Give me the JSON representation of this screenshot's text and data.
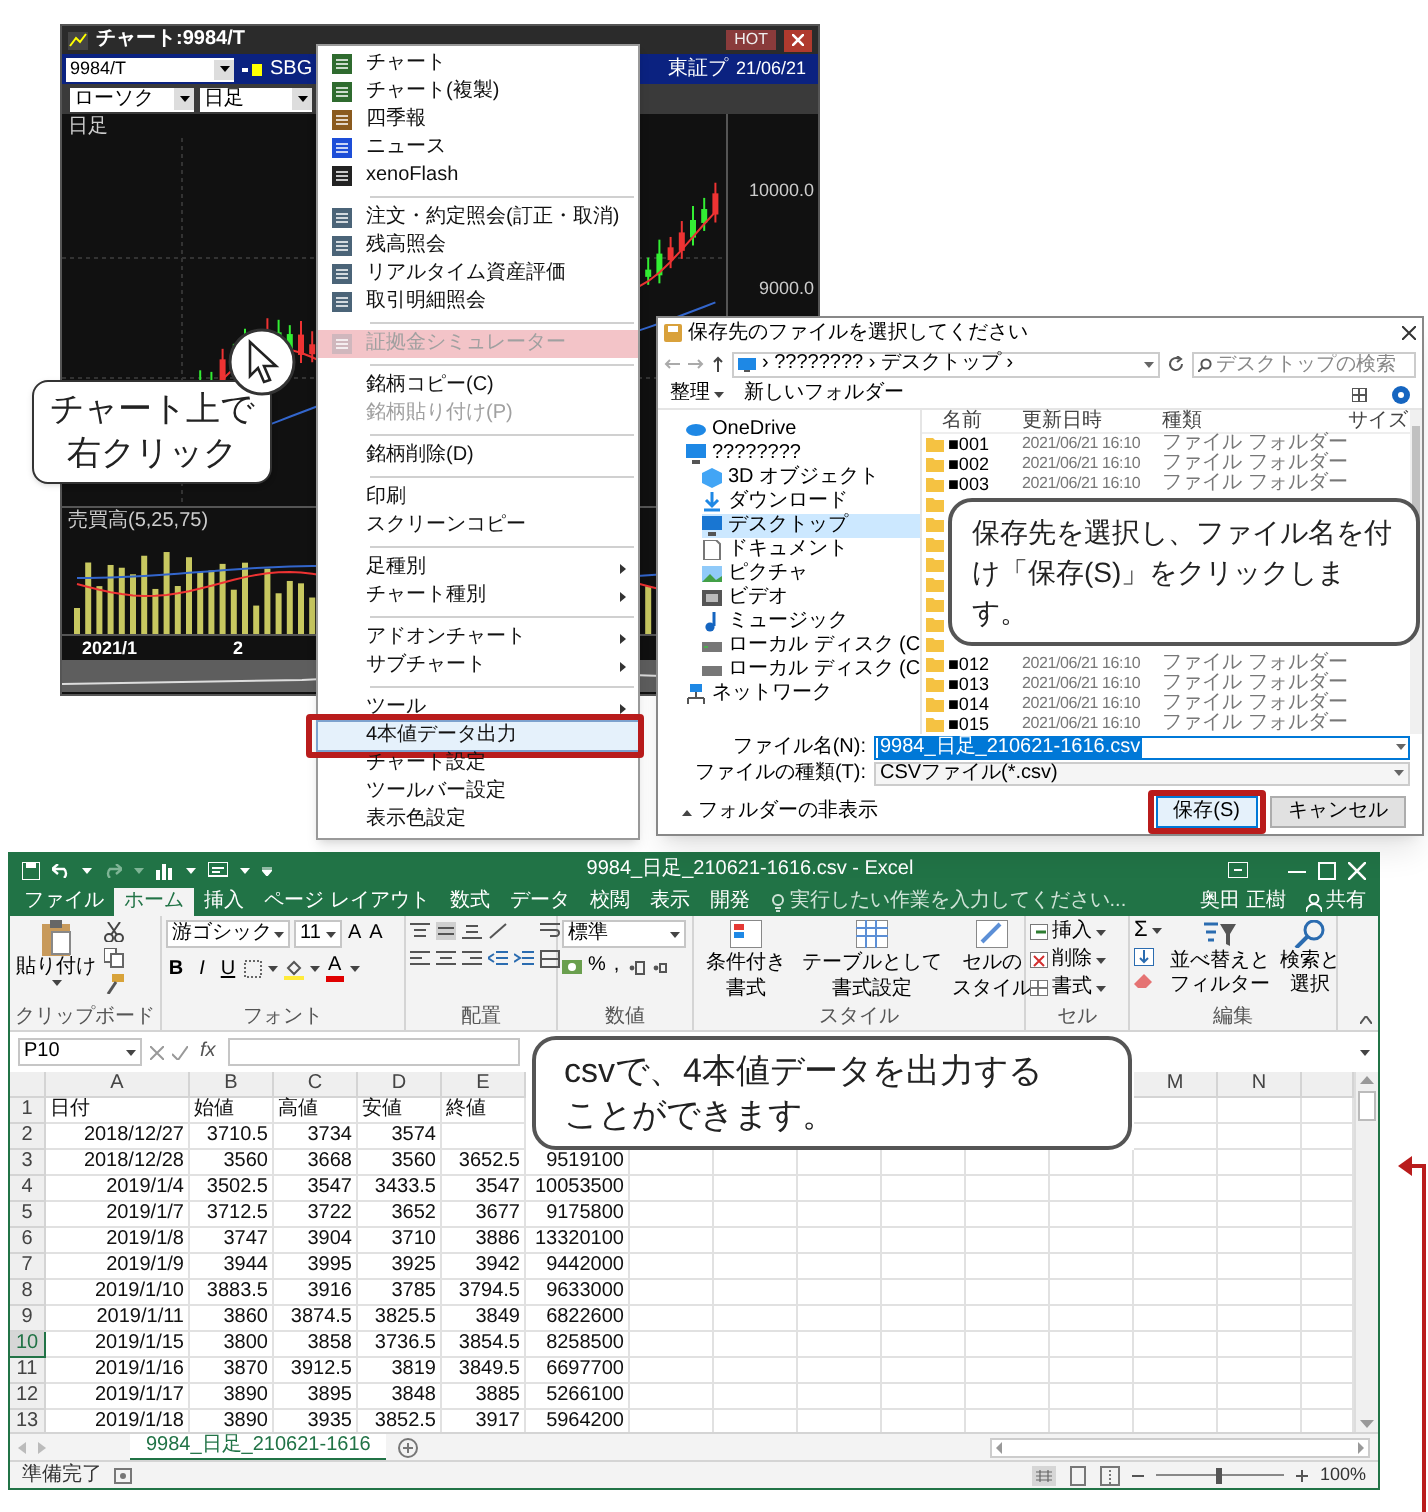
{
  "chart_window": {
    "title": "チャート:9984/T",
    "badge": "HOT",
    "symbol": "9984/T",
    "symbol_name": "SBG",
    "market": "東証プ",
    "date": "21/06/21",
    "chart_type": "ローソク",
    "period": "日足",
    "price_pane_label": "日足",
    "price_axis": [
      "10000.0",
      "9000.0"
    ],
    "volume_pane_label": "売買高(5,25,75)",
    "x_axis": [
      "2021/1",
      "2"
    ]
  },
  "context_menu": {
    "items": [
      {
        "kind": "icon_item",
        "label": "チャート",
        "disabled": false,
        "submenu": false,
        "selected": false,
        "highlighted": false
      },
      {
        "kind": "icon_item",
        "label": "チャート(複製)",
        "disabled": false,
        "submenu": false,
        "selected": false,
        "highlighted": false
      },
      {
        "kind": "icon_item",
        "label": "四季報",
        "disabled": false,
        "submenu": false,
        "selected": false,
        "highlighted": false
      },
      {
        "kind": "icon_item",
        "label": "ニュース",
        "disabled": false,
        "submenu": false,
        "selected": false,
        "highlighted": false
      },
      {
        "kind": "icon_item",
        "label": "xenoFlash",
        "disabled": false,
        "submenu": false,
        "selected": false,
        "highlighted": false
      },
      {
        "kind": "separator"
      },
      {
        "kind": "icon_item",
        "label": "注文・約定照会(訂正・取消)",
        "disabled": false,
        "submenu": false,
        "selected": false,
        "highlighted": false
      },
      {
        "kind": "icon_item",
        "label": "残高照会",
        "disabled": false,
        "submenu": false,
        "selected": false,
        "highlighted": false
      },
      {
        "kind": "icon_item",
        "label": "リアルタイム資産評価",
        "disabled": false,
        "submenu": false,
        "selected": false,
        "highlighted": false
      },
      {
        "kind": "icon_item",
        "label": "取引明細照会",
        "disabled": false,
        "submenu": false,
        "selected": false,
        "highlighted": false
      },
      {
        "kind": "separator"
      },
      {
        "kind": "icon_item",
        "label": "証拠金シミュレーター",
        "disabled": true,
        "submenu": false,
        "selected": false,
        "highlighted": true
      },
      {
        "kind": "separator"
      },
      {
        "kind": "item",
        "label": "銘柄コピー(C)",
        "disabled": false,
        "submenu": false,
        "selected": false,
        "highlighted": false
      },
      {
        "kind": "item",
        "label": "銘柄貼り付け(P)",
        "disabled": true,
        "submenu": false,
        "selected": false,
        "highlighted": false
      },
      {
        "kind": "separator"
      },
      {
        "kind": "item",
        "label": "銘柄削除(D)",
        "disabled": false,
        "submenu": false,
        "selected": false,
        "highlighted": false
      },
      {
        "kind": "separator"
      },
      {
        "kind": "item",
        "label": "印刷",
        "disabled": false,
        "submenu": false,
        "selected": false,
        "highlighted": false
      },
      {
        "kind": "item",
        "label": "スクリーンコピー",
        "disabled": false,
        "submenu": false,
        "selected": false,
        "highlighted": false
      },
      {
        "kind": "separator"
      },
      {
        "kind": "item",
        "label": "足種別",
        "disabled": false,
        "submenu": true,
        "selected": false,
        "highlighted": false
      },
      {
        "kind": "item",
        "label": "チャート種別",
        "disabled": false,
        "submenu": true,
        "selected": false,
        "highlighted": false
      },
      {
        "kind": "separator"
      },
      {
        "kind": "item",
        "label": "アドオンチャート",
        "disabled": false,
        "submenu": true,
        "selected": false,
        "highlighted": false
      },
      {
        "kind": "item",
        "label": "サブチャート",
        "disabled": false,
        "submenu": true,
        "selected": false,
        "highlighted": false
      },
      {
        "kind": "separator"
      },
      {
        "kind": "item",
        "label": "ツール",
        "disabled": false,
        "submenu": true,
        "selected": false,
        "highlighted": false
      },
      {
        "kind": "item",
        "label": "4本値データ出力",
        "disabled": false,
        "submenu": false,
        "selected": true,
        "highlighted": false
      },
      {
        "kind": "item",
        "label": "チャート設定",
        "disabled": false,
        "submenu": false,
        "selected": false,
        "highlighted": false
      },
      {
        "kind": "item",
        "label": "ツールバー設定",
        "disabled": false,
        "submenu": false,
        "selected": false,
        "highlighted": false
      },
      {
        "kind": "item",
        "label": "表示色設定",
        "disabled": false,
        "submenu": false,
        "selected": false,
        "highlighted": false
      }
    ]
  },
  "save_dialog": {
    "title": "保存先のファイルを選択してください",
    "path": "› ???????? › デスクトップ ›",
    "search_placeholder": "デスクトップの検索",
    "toolbar": [
      "整理",
      "新しいフォルダー"
    ],
    "nav": [
      {
        "label": "OneDrive",
        "selected": false
      },
      {
        "label": "????????",
        "selected": false,
        "children": [
          {
            "label": "3D オブジェクト",
            "selected": false
          },
          {
            "label": "ダウンロード",
            "selected": false
          },
          {
            "label": "デスクトップ",
            "selected": true
          },
          {
            "label": "ドキュメント",
            "selected": false
          },
          {
            "label": "ピクチャ",
            "selected": false
          },
          {
            "label": "ビデオ",
            "selected": false
          },
          {
            "label": "ミュージック",
            "selected": false
          },
          {
            "label": "ローカル ディスク (C",
            "selected": false
          },
          {
            "label": "ローカル ディスク (C",
            "selected": false
          }
        ]
      },
      {
        "label": "ネットワーク",
        "selected": false
      }
    ],
    "columns": [
      "名前",
      "更新日時",
      "種類",
      "サイズ"
    ],
    "files": [
      {
        "kind": "folder",
        "name": "■001",
        "modified": "2021/06/21 16:10",
        "type": "ファイル フォルダー"
      },
      {
        "kind": "folder",
        "name": "■002",
        "modified": "2021/06/21 16:10",
        "type": "ファイル フォルダー"
      },
      {
        "kind": "folder",
        "name": "■003",
        "modified": "2021/06/21 16:10",
        "type": "ファイル フォルダー"
      },
      {
        "kind": "covered"
      },
      {
        "kind": "covered"
      },
      {
        "kind": "covered"
      },
      {
        "kind": "covered"
      },
      {
        "kind": "covered"
      },
      {
        "kind": "covered"
      },
      {
        "kind": "covered"
      },
      {
        "kind": "covered"
      },
      {
        "kind": "folder",
        "name": "■012",
        "modified": "2021/06/21 16:10",
        "type": "ファイル フォルダー"
      },
      {
        "kind": "folder",
        "name": "■013",
        "modified": "2021/06/21 16:10",
        "type": "ファイル フォルダー"
      },
      {
        "kind": "folder",
        "name": "■014",
        "modified": "2021/06/21 16:10",
        "type": "ファイル フォルダー"
      },
      {
        "kind": "folder",
        "name": "■015",
        "modified": "2021/06/21 16:10",
        "type": "ファイル フォルダー"
      }
    ],
    "file_name_label": "ファイル名(N):",
    "file_name": {
      "value": "9984_日足_210621-1616.csv",
      "highlighted": true
    },
    "file_type_label": "ファイルの種類(T):",
    "file_type": "CSVファイル(*.csv)",
    "hide_folders": "フォルダーの非表示",
    "buttons": [
      {
        "label": "保存(S)",
        "highlighted": true
      },
      {
        "label": "キャンセル",
        "highlighted": false
      }
    ]
  },
  "excel": {
    "title": "9984_日足_210621-1616.csv - Excel",
    "tabs": [
      {
        "label": "ファイル",
        "selected": false
      },
      {
        "label": "ホーム",
        "selected": true
      },
      {
        "label": "挿入",
        "selected": false
      },
      {
        "label": "ページ レイアウト",
        "selected": false
      },
      {
        "label": "数式",
        "selected": false
      },
      {
        "label": "データ",
        "selected": false
      },
      {
        "label": "校閲",
        "selected": false
      },
      {
        "label": "表示",
        "selected": false
      },
      {
        "label": "開発",
        "selected": false
      }
    ],
    "tell_me": "実行したい作業を入力してください...",
    "user": "奥田 正樹",
    "share": "共有",
    "ribbon": {
      "clipboard": {
        "paste": "貼り付け",
        "label": "クリップボード"
      },
      "font": {
        "name": "游ゴシック",
        "size": "11",
        "grow": "A",
        "shrink": "A",
        "format": [
          "B",
          "I",
          "U"
        ],
        "color_button": "A",
        "label": "フォント"
      },
      "alignment": {
        "label": "配置"
      },
      "number": {
        "format": "標準",
        "percent": "%",
        "comma": ",",
        "label": "数値"
      },
      "styles": {
        "buttons": [
          {
            "lines": [
              "条件付き",
              "書式"
            ]
          },
          {
            "lines": [
              "テーブルとして",
              "書式設定"
            ]
          },
          {
            "lines": [
              "セルの",
              "スタイル"
            ]
          }
        ],
        "label": "スタイル"
      },
      "cells": {
        "buttons": [
          "挿入",
          "削除",
          "書式"
        ],
        "label": "セル"
      },
      "editing": {
        "sum": "Σ",
        "buttons": [
          {
            "lines": [
              "並べ替えと",
              "フィルター"
            ]
          },
          {
            "lines": [
              "検索と",
              "選択"
            ]
          }
        ],
        "label": "編集"
      }
    },
    "name_box": "P10",
    "formula_button": "fx",
    "column_headers": [
      "A",
      "B",
      "C",
      "D",
      "E",
      "M",
      "N"
    ],
    "rows": [
      {
        "header": "1",
        "kind": "header",
        "selected": false,
        "cells": [
          "日付",
          "始値",
          "高値",
          "安値",
          "終値"
        ]
      },
      {
        "header": "2",
        "kind": "data",
        "selected": false,
        "cells": [
          "2018/12/27",
          "3710.5",
          "3734",
          "3574"
        ]
      },
      {
        "header": "3",
        "kind": "data",
        "selected": false,
        "cells": [
          "2018/12/28",
          "3560",
          "3668",
          "3560",
          "3652.5",
          "9519100"
        ]
      },
      {
        "header": "4",
        "kind": "data",
        "selected": false,
        "cells": [
          "2019/1/4",
          "3502.5",
          "3547",
          "3433.5",
          "3547",
          "10053500"
        ]
      },
      {
        "header": "5",
        "kind": "data",
        "selected": false,
        "cells": [
          "2019/1/7",
          "3712.5",
          "3722",
          "3652",
          "3677",
          "9175800"
        ]
      },
      {
        "header": "6",
        "kind": "data",
        "selected": false,
        "cells": [
          "2019/1/8",
          "3747",
          "3904",
          "3710",
          "3886",
          "13320100"
        ]
      },
      {
        "header": "7",
        "kind": "data",
        "selected": false,
        "cells": [
          "2019/1/9",
          "3944",
          "3995",
          "3925",
          "3942",
          "9442000"
        ]
      },
      {
        "header": "8",
        "kind": "data",
        "selected": false,
        "cells": [
          "2019/1/10",
          "3883.5",
          "3916",
          "3785",
          "3794.5",
          "9633000"
        ]
      },
      {
        "header": "9",
        "kind": "data",
        "selected": false,
        "cells": [
          "2019/1/11",
          "3860",
          "3874.5",
          "3825.5",
          "3849",
          "6822600"
        ]
      },
      {
        "header": "10",
        "kind": "data",
        "selected": true,
        "cells": [
          "2019/1/15",
          "3800",
          "3858",
          "3736.5",
          "3854.5",
          "8258500"
        ]
      },
      {
        "header": "11",
        "kind": "data",
        "selected": false,
        "cells": [
          "2019/1/16",
          "3870",
          "3912.5",
          "3819",
          "3849.5",
          "6697700"
        ]
      },
      {
        "header": "12",
        "kind": "data",
        "selected": false,
        "cells": [
          "2019/1/17",
          "3890",
          "3895",
          "3848",
          "3885",
          "5266100"
        ]
      },
      {
        "header": "13",
        "kind": "data",
        "selected": false,
        "cells": [
          "2019/1/18",
          "3890",
          "3935",
          "3852.5",
          "3917",
          "5964200"
        ]
      }
    ],
    "sheet_tabs": [
      {
        "label": "9984_日足_210621-1616",
        "selected": true
      }
    ],
    "status": "準備完了",
    "zoom_slider": {
      "level": 0.5
    },
    "zoom": "100%"
  },
  "annotations": {
    "right_click_callout": [
      "チャート上で",
      "右クリック"
    ],
    "save_callout": "保存先を選択し、ファイル名を付け「保存(S)」をクリックします。",
    "csv_callout": [
      "csvで、4本値データを出力する",
      "ことができます。"
    ]
  }
}
